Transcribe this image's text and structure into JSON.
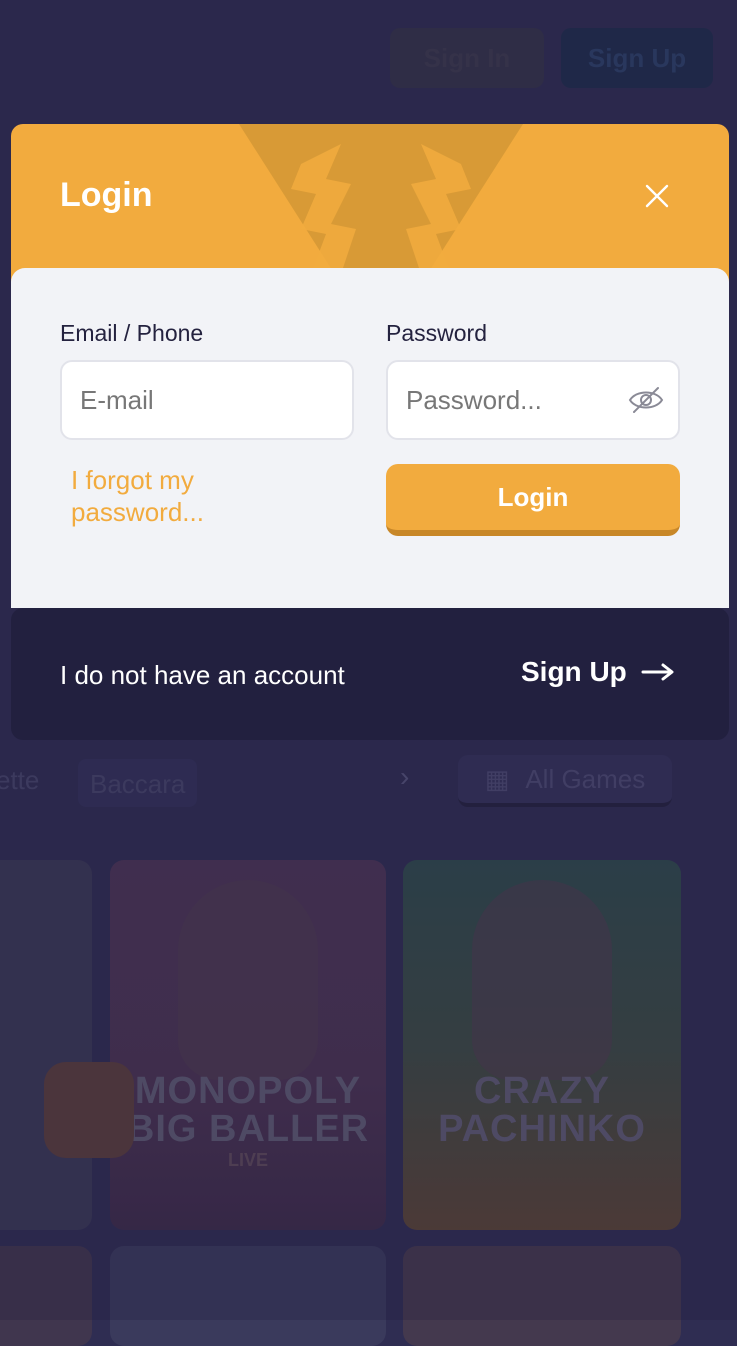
{
  "background": {
    "header": {
      "sign_in_label": "Sign In",
      "sign_up_label": "Sign Up"
    },
    "category_tabs": [
      "ette",
      "Baccara"
    ],
    "all_games_label": "All Games",
    "games": [
      {
        "title": "MONOPOLY BIG BALLER",
        "subtitle": "LIVE"
      },
      {
        "title": "CRAZY PACHINKO",
        "subtitle": ""
      }
    ]
  },
  "modal": {
    "title": "Login",
    "email_label": "Email / Phone",
    "email_placeholder": "E-mail",
    "password_label": "Password",
    "password_placeholder": "Password...",
    "forgot_link": "I forgot my password...",
    "login_button": "Login",
    "footer_text": "I do not have an account",
    "signup_label": "Sign Up"
  },
  "colors": {
    "accent": "#f2ab3e",
    "footer_bg": "#22203f",
    "body_bg": "#f2f3f7",
    "page_bg": "#2f2d52"
  },
  "icons": [
    "close-icon",
    "eye-off-icon",
    "arrow-right-icon",
    "grid-icon",
    "chevron-right-icon"
  ]
}
